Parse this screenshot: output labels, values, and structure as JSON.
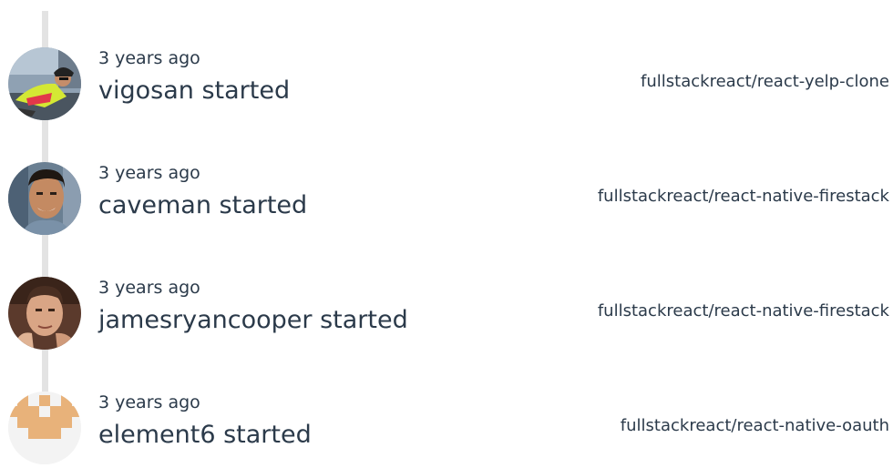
{
  "events": [
    {
      "time": "3 years ago",
      "actor": "vigosan",
      "action": "started",
      "repo": "fullstackreact/react-yelp-clone",
      "avatar_icon": "cyclist-photo-avatar"
    },
    {
      "time": "3 years ago",
      "actor": "caveman",
      "action": "started",
      "repo": "fullstackreact/react-native-firestack",
      "avatar_icon": "smiling-man-photo-avatar"
    },
    {
      "time": "3 years ago",
      "actor": "jamesryancooper",
      "action": "started",
      "repo": "fullstackreact/react-native-firestack",
      "avatar_icon": "man-portrait-photo-avatar"
    },
    {
      "time": "3 years ago",
      "actor": "element6",
      "action": "started",
      "repo": "fullstackreact/react-native-oauth",
      "avatar_icon": "identicon-avatar"
    }
  ],
  "colors": {
    "text": "#2b3a4a",
    "timeline": "#e3e3e3",
    "identicon": "#e8b27a"
  }
}
